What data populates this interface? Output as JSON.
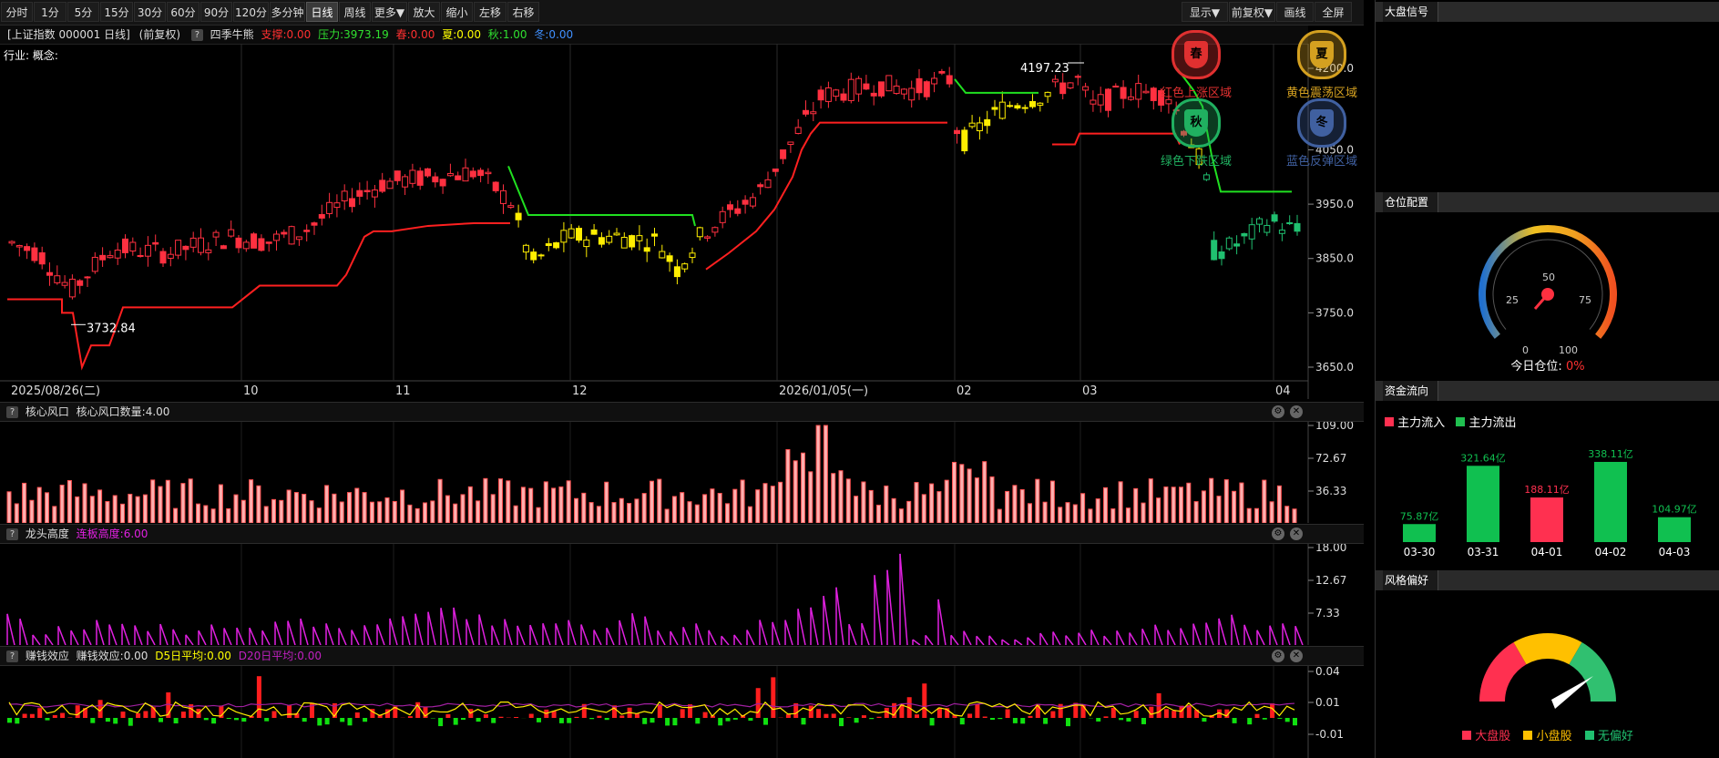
{
  "toolbar": {
    "left": [
      "分时",
      "1分",
      "5分",
      "15分",
      "30分",
      "60分",
      "90分",
      "120分",
      "多分钟",
      "日线",
      "周线",
      "更多▼",
      "放大",
      "缩小",
      "左移",
      "右移"
    ],
    "active": "日线",
    "right": [
      "显示▼",
      "前复权▼",
      "画线",
      "全屏"
    ]
  },
  "infobar": {
    "title": "[上证指数 000001 日线]",
    "adjust": "(前复权)",
    "q": "?",
    "indicator": "四季牛熊",
    "support": "支撑:0.00",
    "pressure": "压力:3973.19",
    "spring": "春:0.00",
    "summer": "夏:0.00",
    "autumn": "秋:1.00",
    "winter": "冬:0.00",
    "industry": "行业: 概念:"
  },
  "main_chart": {
    "price_ticks": [
      "4200.0",
      "4050.0",
      "3950.0",
      "3850.0",
      "3750.0",
      "3650.0"
    ],
    "high_label": "4197.23",
    "low_label": "3732.84",
    "dates": [
      "2025/08/26(二)",
      "10",
      "11",
      "12",
      "2026/01/05(一)",
      "02",
      "03",
      "04"
    ]
  },
  "panel1": {
    "label": "核心风口",
    "value": "核心风口数量:4.00",
    "ticks": [
      "109.00",
      "72.67",
      "36.33"
    ]
  },
  "panel2": {
    "label": "龙头高度",
    "value": "连板高度:6.00",
    "ticks": [
      "18.00",
      "12.67",
      "7.33"
    ]
  },
  "panel3": {
    "label": "赚钱效应",
    "value": "赚钱效应:0.00",
    "d5": "D5日平均:0.00",
    "d20": "D20日平均:0.00",
    "ticks": [
      "0.04",
      "0.01",
      "-0.01"
    ]
  },
  "right_panel": {
    "signal_title": "大盘信号",
    "seasons": [
      {
        "char": "春",
        "label": "红色上涨区域",
        "color": "#e03030"
      },
      {
        "char": "夏",
        "label": "黄色震荡区域",
        "color": "#d4a020"
      },
      {
        "char": "秋",
        "label": "绿色下跌区域",
        "color": "#20b060"
      },
      {
        "char": "冬",
        "label": "蓝色反弹区域",
        "color": "#4060a0"
      }
    ],
    "position_title": "仓位配置",
    "gauge_ticks": [
      "0",
      "25",
      "50",
      "75",
      "100"
    ],
    "position_label": "今日仓位:",
    "position_value": "0%",
    "flow_title": "资金流向",
    "flow_legend_in": "主力流入",
    "flow_legend_out": "主力流出",
    "flow": [
      {
        "date": "03-30",
        "value": 75.87,
        "label": "75.87亿",
        "dir": "out"
      },
      {
        "date": "03-31",
        "value": 321.64,
        "label": "321.64亿",
        "dir": "out"
      },
      {
        "date": "04-01",
        "value": 188.11,
        "label": "188.11亿",
        "dir": "in"
      },
      {
        "date": "04-02",
        "value": 338.11,
        "label": "338.11亿",
        "dir": "out"
      },
      {
        "date": "04-03",
        "value": 104.97,
        "label": "104.97亿",
        "dir": "out"
      }
    ],
    "style_title": "风格偏好",
    "style_legend": [
      "大盘股",
      "小盘股",
      "无偏好"
    ]
  }
}
